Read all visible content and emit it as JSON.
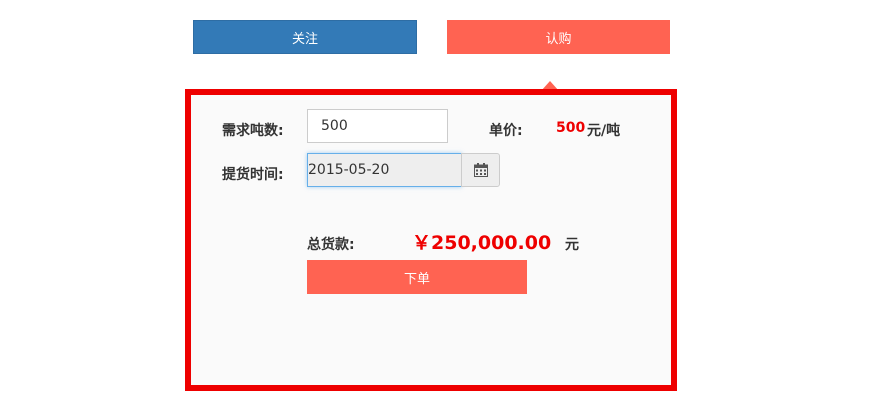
{
  "tabs": {
    "follow_label": "关注",
    "subscribe_label": "认购"
  },
  "form": {
    "qty_label": "需求吨数:",
    "qty_value": "500",
    "price_label": "单价:",
    "price_value": "500",
    "price_unit": "元/吨",
    "date_label": "提货时间:",
    "date_value": "2015-05-20",
    "calendar_icon": "calendar-icon",
    "total_label": "总货款:",
    "total_value": "￥250,000.00",
    "total_unit": "元",
    "order_label": "下单"
  },
  "colors": {
    "primary": "#337ab7",
    "accent": "#ff6352",
    "highlight": "#ee0000"
  }
}
